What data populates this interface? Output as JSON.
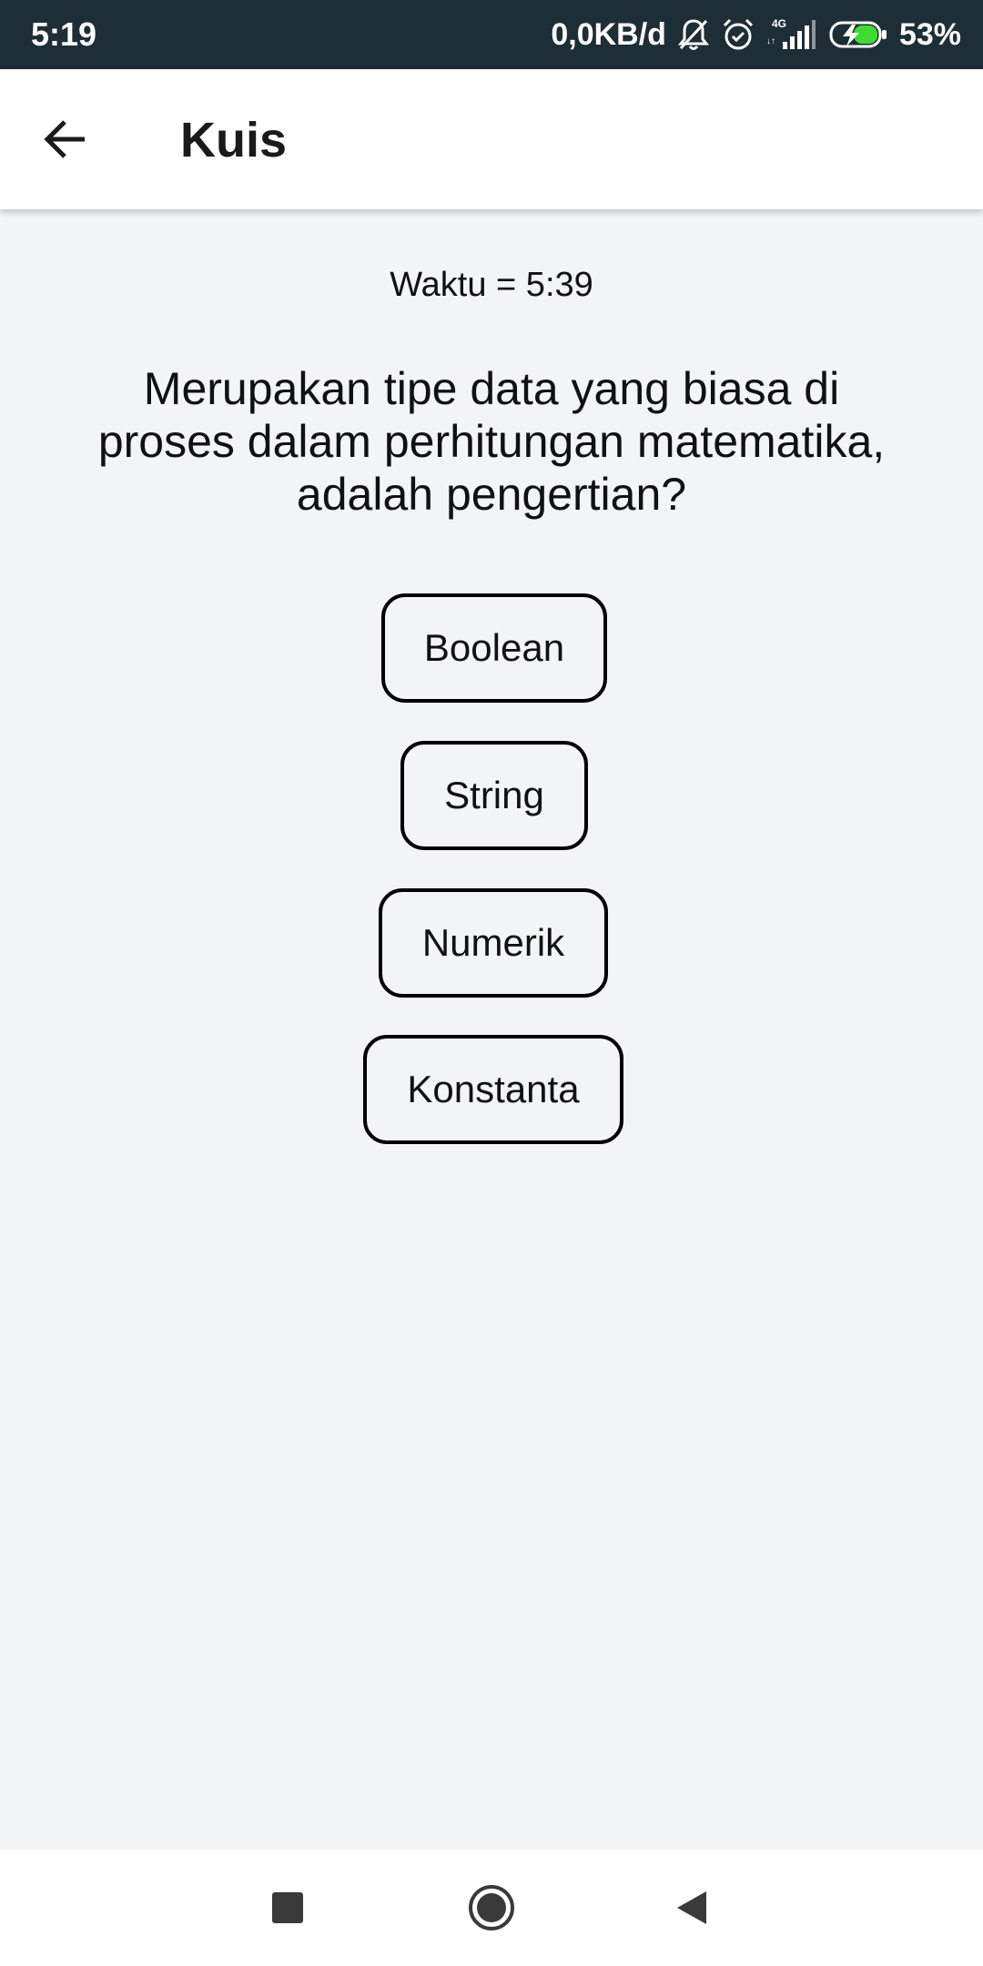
{
  "status_bar": {
    "time": "5:19",
    "network_speed": "0,0KB/d",
    "network_type": "4G",
    "battery": "53%",
    "icons": [
      "bell-off-icon",
      "alarm-icon",
      "signal-icon",
      "battery-charging-icon"
    ],
    "background": "#1e2e37"
  },
  "app_bar": {
    "title": "Kuis",
    "back_icon": "arrow-left-icon"
  },
  "quiz": {
    "timer": "Waktu = 5:39",
    "question": "Merupakan tipe data yang biasa di proses dalam perhitungan matematika, adalah pengertian?",
    "options": [
      {
        "label": "Boolean"
      },
      {
        "label": "String"
      },
      {
        "label": "Numerik"
      },
      {
        "label": "Konstanta"
      }
    ]
  },
  "nav_bar": {
    "items": [
      "recents-icon",
      "home-icon",
      "back-triangle-icon"
    ]
  },
  "colors": {
    "background": "#f3f4f6",
    "app_bar": "#ffffff",
    "button_border": "#000000",
    "battery_accent": "#3ddc2f"
  }
}
